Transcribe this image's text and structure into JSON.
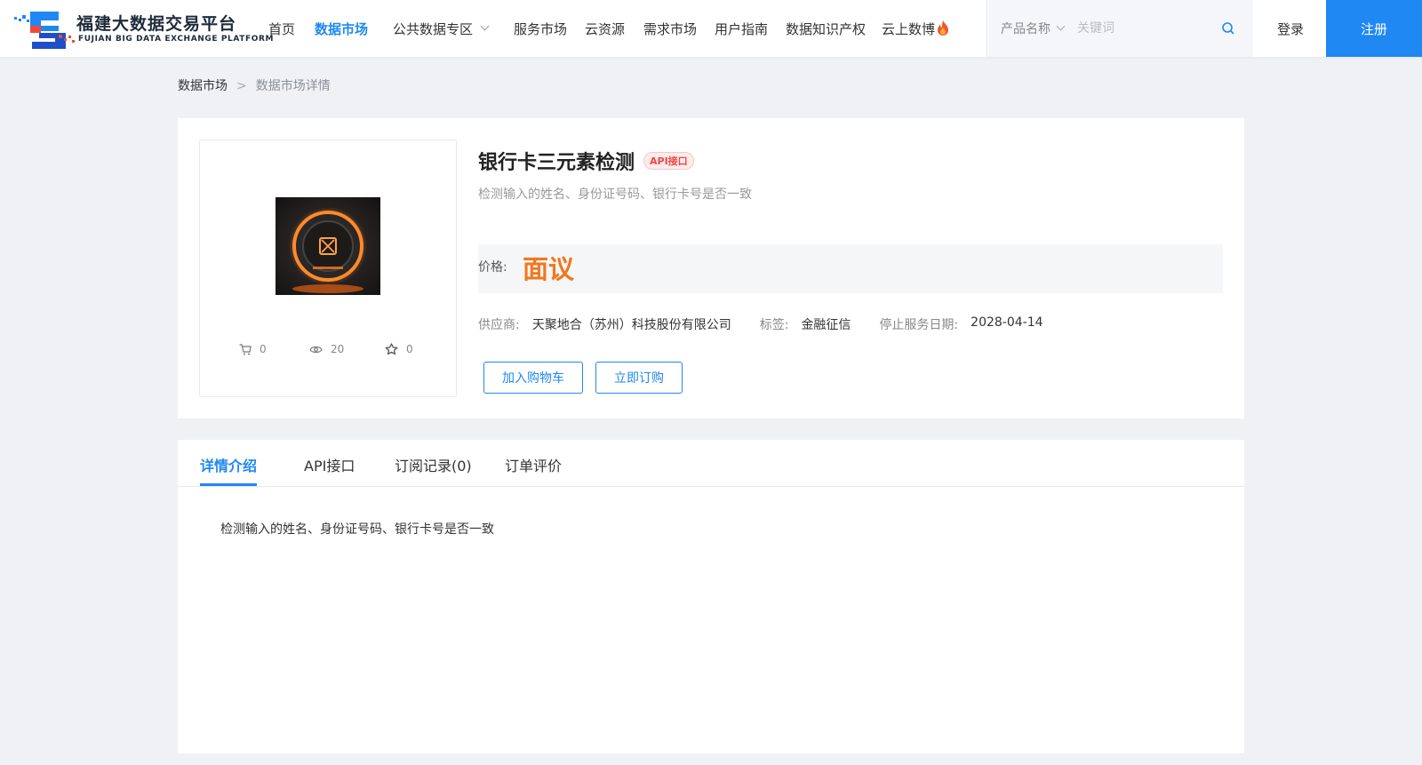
{
  "brand": {
    "title": "福建大数据交易平台",
    "subtitle": "FUJIAN BIG DATA EXCHANGE  PLATFORM"
  },
  "nav": {
    "home": "首页",
    "data_market": "数据市场",
    "public_data": "公共数据专区",
    "service_market": "服务市场",
    "cloud_resources": "云资源",
    "demand_market": "需求市场",
    "user_guide": "用户指南",
    "data_ip": "数据知识产权",
    "cloud_expo": "云上数博"
  },
  "search": {
    "category": "产品名称",
    "placeholder": "关键词"
  },
  "auth": {
    "login": "登录",
    "register": "注册"
  },
  "breadcrumb": {
    "home": "数据市场",
    "separator": ">",
    "current": "数据市场详情"
  },
  "product": {
    "title": "银行卡三元素检测",
    "badge": "API接口",
    "description": "检测输入的姓名、身份证号码、银行卡号是否一致",
    "price_label": "价格:",
    "price_value": "面议",
    "supplier_label": "供应商:",
    "supplier": "天聚地合（苏州）科技股份有限公司",
    "tag_label": "标签:",
    "tag": "金融征信",
    "end_date_label": "停止服务日期:",
    "end_date": "2028-04-14",
    "add_to_cart": "加入购物车",
    "subscribe": "立即订购",
    "stats": {
      "cart": "0",
      "views": "20",
      "favorites": "0"
    }
  },
  "tabs": {
    "details": "详情介绍",
    "api": "API接口",
    "records": "订阅记录(0)",
    "reviews": "订单评价"
  },
  "details": {
    "text": "检测输入的姓名、身份证号码、银行卡号是否一致"
  },
  "colors": {
    "primary": "#1f88f2",
    "price": "#f2771e",
    "badge": "#ee4747"
  }
}
